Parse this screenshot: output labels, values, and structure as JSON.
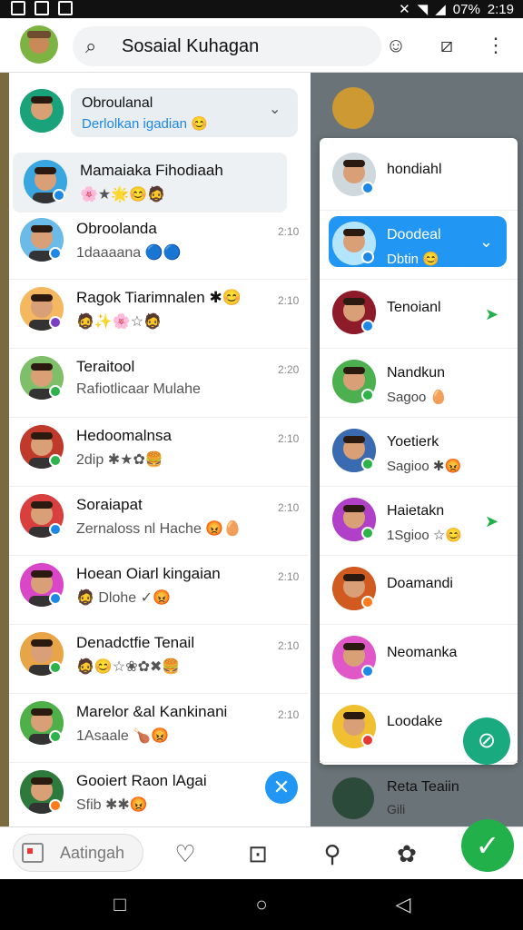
{
  "status_bar": {
    "battery": "07%",
    "time": "2:19"
  },
  "header": {
    "search_text": "Sosaial Kuhagan"
  },
  "folder": {
    "title": "Obroulanal",
    "subtitle": "Derlolkan igadian 😊"
  },
  "chats": [
    {
      "name": "Mamaiaka Fihodiaah",
      "preview": "🌸★🌟😊🧔",
      "time": "",
      "avatar": "#3aa6e0",
      "badge": "#1e88e5"
    },
    {
      "name": "Obroolanda",
      "preview": "1daaaana 🔵🔵",
      "time": "2:10",
      "avatar": "#6bbbe8",
      "badge": "#1e88e5"
    },
    {
      "name": "Ragok Tiarimnalen ✱😊",
      "preview": "🧔✨🌸☆🧔",
      "time": "2:10",
      "avatar": "#f4b860",
      "badge": "#7b3fc4"
    },
    {
      "name": "Teraitool",
      "preview": "Rafiotlicaar Mulahe",
      "time": "2:20",
      "avatar": "#7fbf6a",
      "badge": "#2db34a"
    },
    {
      "name": "Hedoomalnsa",
      "preview": "2dip ✱★✿🍔",
      "time": "2:10",
      "avatar": "#c03a2b",
      "badge": "#2db34a"
    },
    {
      "name": "Soraiapat",
      "preview": "Zernaloss nl Hache 😡🥚",
      "time": "2:10",
      "avatar": "#d93f3f",
      "badge": "#1e88e5"
    },
    {
      "name": "Hoean Oiarl kingaian",
      "preview": "🧔 Dlohe ✓😡",
      "time": "2:10",
      "avatar": "#d946c8",
      "badge": "#1e88e5"
    },
    {
      "name": "Denadctfie Tenail",
      "preview": "🧔😊☆❀✿✖🍔",
      "time": "2:10",
      "avatar": "#e8a548",
      "badge": "#2db34a"
    },
    {
      "name": "Marelor &al Kankinani",
      "preview": "1Asaale 🍗😡",
      "time": "2:10",
      "avatar": "#4fb04a",
      "badge": "#2db34a"
    },
    {
      "name": "Gooiert Raon lAgai",
      "preview": "Sfib ✱✱😡",
      "time": "",
      "avatar": "#2e7a3c",
      "badge": "#ff7a1a"
    }
  ],
  "right_panel": [
    {
      "name": "hondiahl",
      "sub": "",
      "avatar": "#cfd8dc",
      "badge": "#1e88e5"
    },
    {
      "name": "Doodeal",
      "sub": "Dbtin 😊",
      "avatar": "#b3e5fc",
      "badge": "#1e88e5"
    },
    {
      "name": "Tenoianl",
      "sub": "",
      "avatar": "#8e1b2a",
      "badge": "#1e88e5"
    },
    {
      "name": "Nandkun",
      "sub": "Sagoo 🥚",
      "avatar": "#4caf50",
      "badge": "#2db34a"
    },
    {
      "name": "Yoetierk",
      "sub": "Sagioo ✱😡",
      "avatar": "#3a6ab0",
      "badge": "#2db34a"
    },
    {
      "name": "Haietakn",
      "sub": "1Sgioo ☆😊",
      "avatar": "#b040c8",
      "badge": "#2db34a"
    },
    {
      "name": "Doamandi",
      "sub": "",
      "avatar": "#d05a20",
      "badge": "#ff7a1a"
    },
    {
      "name": "Neomanka",
      "sub": "",
      "avatar": "#e058c8",
      "badge": "#1e88e5"
    },
    {
      "name": "Loodake",
      "sub": "",
      "avatar": "#f0c030",
      "badge": "#e53935"
    }
  ],
  "behind": {
    "name": "Reta Teaiin",
    "sub": "Gili"
  },
  "bottom": {
    "pill_text": "Aatingah"
  }
}
